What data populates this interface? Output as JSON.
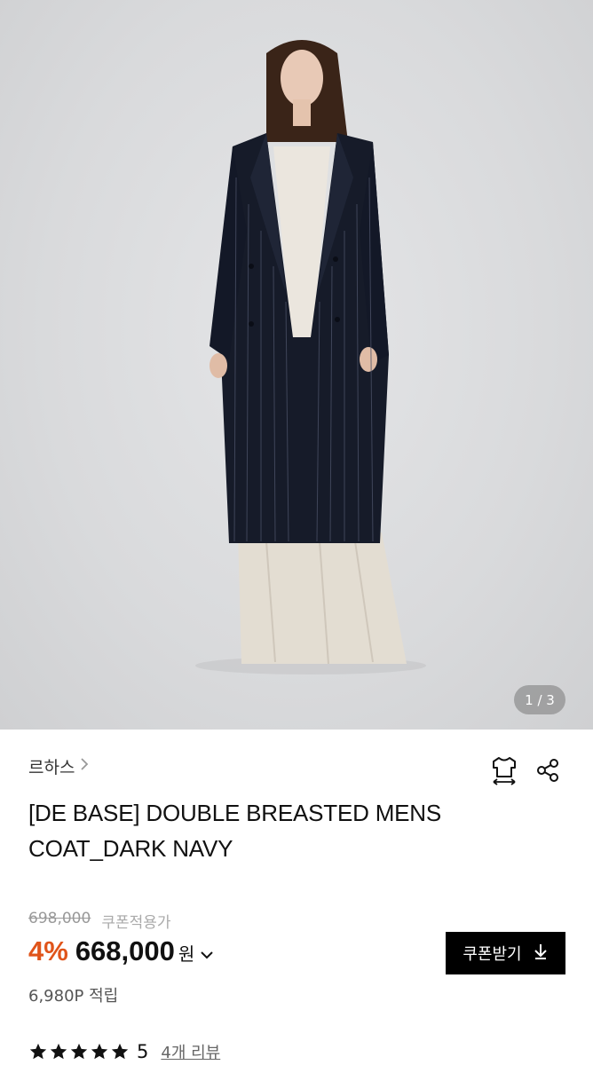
{
  "gallery": {
    "counter": "1 / 3"
  },
  "brand": {
    "name": "르하스"
  },
  "product": {
    "title": "[DE BASE] DOUBLE BREASTED MENS COAT_DARK NAVY"
  },
  "pricing": {
    "original_price": "698,000",
    "coupon_note": "쿠폰적용가",
    "discount": "4%",
    "price": "668,000",
    "currency": "원",
    "coupon_button": "쿠폰받기",
    "points": "6,980P 적립"
  },
  "rating": {
    "score": "5",
    "stars": 5,
    "reviews": "4개 리뷰"
  },
  "colors": {
    "discount": "#e0541a",
    "button_bg": "#000000"
  },
  "icons": [
    "chevron-right-icon",
    "size-guide-shirt-icon",
    "share-icon",
    "chevron-down-icon",
    "download-arrow-icon",
    "star-icon"
  ]
}
